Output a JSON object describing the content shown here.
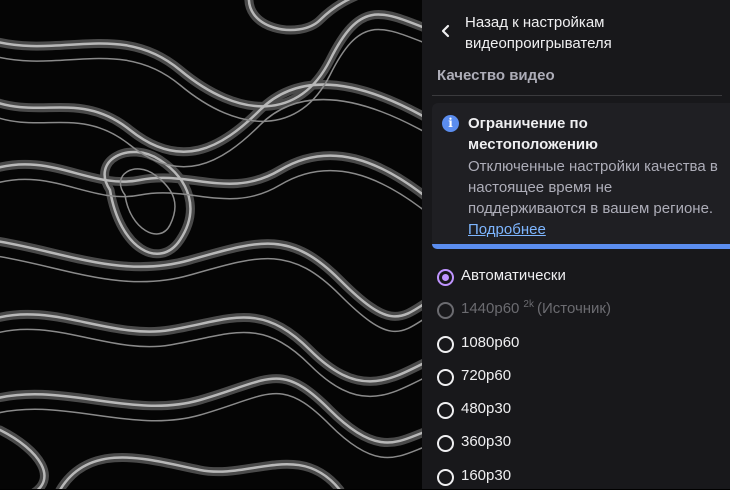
{
  "back": {
    "label": "Назад к настройкам видеопроигрывателя"
  },
  "section_title": "Качество видео",
  "notice": {
    "title": "Ограничение по местоположению",
    "body": "Отключенные настройки качества в настоящее время не поддерживаются в вашем регионе. ",
    "link": "Подробнее",
    "accent_color": "#5b8def"
  },
  "quality_options": [
    {
      "label": "Автоматически",
      "selected": true,
      "disabled": false
    },
    {
      "label": "1440p60",
      "badge": "2k",
      "suffix": "(Источник)",
      "selected": false,
      "disabled": true
    },
    {
      "label": "1080p60",
      "selected": false,
      "disabled": false
    },
    {
      "label": "720p60",
      "selected": false,
      "disabled": false
    },
    {
      "label": "480p30",
      "selected": false,
      "disabled": false
    },
    {
      "label": "360p30",
      "selected": false,
      "disabled": false
    },
    {
      "label": "160p30",
      "selected": false,
      "disabled": false
    }
  ],
  "colors": {
    "panel_bg": "#18181b",
    "selected": "#bf94ff",
    "disabled": "#6b6b70"
  }
}
